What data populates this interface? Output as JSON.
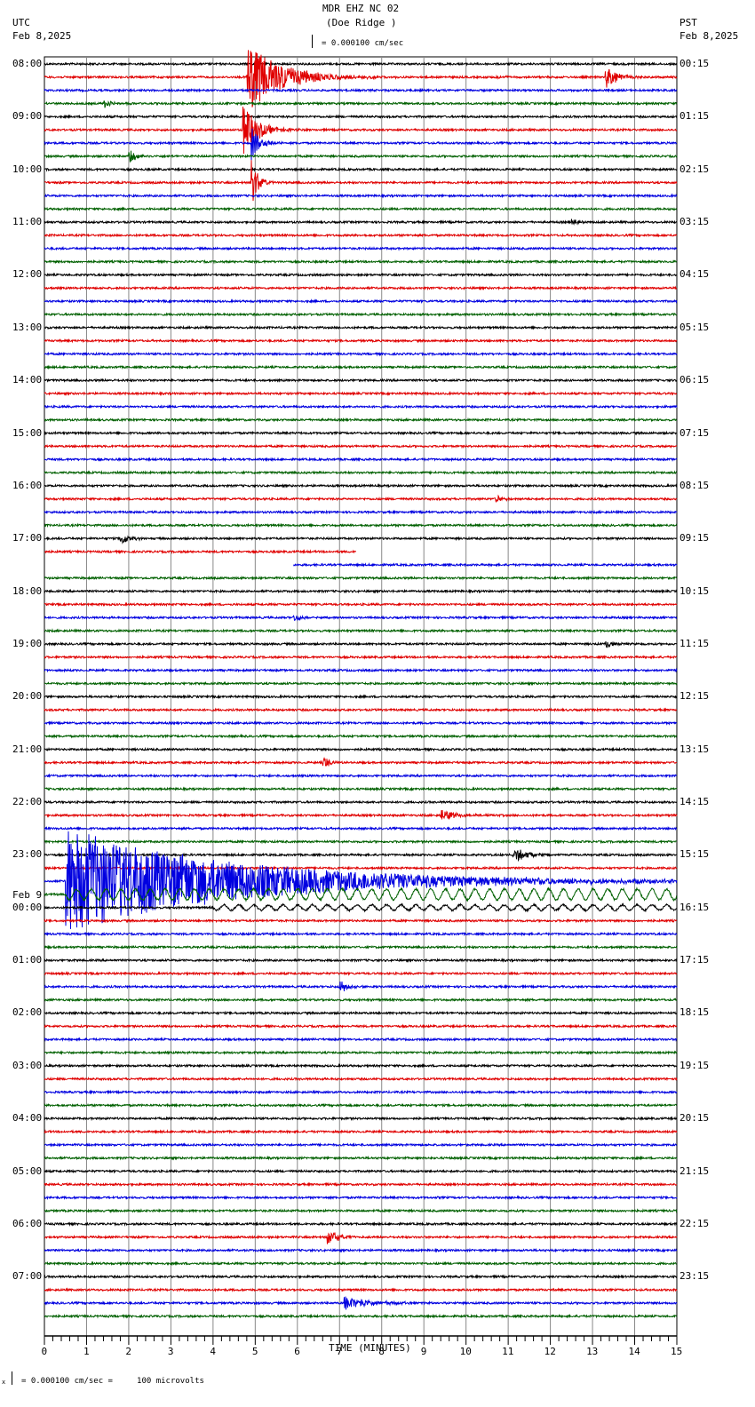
{
  "header": {
    "title": "MDR EHZ NC 02",
    "subtitle": "(Doe Ridge )",
    "scale": "= 0.000100 cm/sec",
    "left_tz": "UTC",
    "left_date": "Feb 8,2025",
    "right_tz": "PST",
    "right_date": "Feb 8,2025"
  },
  "footer": {
    "scale_note": "= 0.000100 cm/sec =     100 microvolts",
    "scale_prefix": "x"
  },
  "chart_data": {
    "type": "line",
    "title": "MDR EHZ NC 02 (Doe Ridge )",
    "xlabel": "TIME (MINUTES)",
    "xlim": [
      0,
      15
    ],
    "x_ticks": [
      "0",
      "1",
      "2",
      "3",
      "4",
      "5",
      "6",
      "7",
      "8",
      "9",
      "10",
      "11",
      "12",
      "13",
      "14",
      "15"
    ],
    "traces_per_hour": 4,
    "trace_count": 96,
    "trace_colors": [
      "#000000",
      "#e00000",
      "#0000e0",
      "#006000"
    ],
    "left_labels": [
      "08:00",
      "09:00",
      "10:00",
      "11:00",
      "12:00",
      "13:00",
      "14:00",
      "15:00",
      "16:00",
      "17:00",
      "18:00",
      "19:00",
      "20:00",
      "21:00",
      "22:00",
      "23:00",
      "00:00",
      "01:00",
      "02:00",
      "03:00",
      "04:00",
      "05:00",
      "06:00",
      "07:00"
    ],
    "date_change_label": "Feb 9",
    "right_labels": [
      "00:15",
      "01:15",
      "02:15",
      "03:15",
      "04:15",
      "05:15",
      "06:15",
      "07:15",
      "08:15",
      "09:15",
      "10:15",
      "11:15",
      "12:15",
      "13:15",
      "14:15",
      "15:15",
      "16:15",
      "17:15",
      "18:15",
      "19:15",
      "20:15",
      "21:15",
      "22:15",
      "23:15"
    ],
    "events": [
      {
        "trace": 1,
        "minute": 4.8,
        "amp": 40,
        "dur": 1.2
      },
      {
        "trace": 1,
        "minute": 13.3,
        "amp": 14,
        "dur": 0.4
      },
      {
        "trace": 1,
        "minute": 10.7,
        "amp": 4,
        "dur": 0.2
      },
      {
        "trace": 3,
        "minute": 1.4,
        "amp": 6,
        "dur": 0.3
      },
      {
        "trace": 5,
        "minute": 4.7,
        "amp": 30,
        "dur": 0.5
      },
      {
        "trace": 6,
        "minute": 4.9,
        "amp": 20,
        "dur": 0.3
      },
      {
        "trace": 7,
        "minute": 2.0,
        "amp": 9,
        "dur": 0.3
      },
      {
        "trace": 9,
        "minute": 4.9,
        "amp": 35,
        "dur": 0.2
      },
      {
        "trace": 12,
        "minute": 12.5,
        "amp": 4,
        "dur": 0.2
      },
      {
        "trace": 33,
        "minute": 10.7,
        "amp": 5,
        "dur": 0.2
      },
      {
        "trace": 36,
        "minute": 1.8,
        "amp": 8,
        "dur": 0.3
      },
      {
        "trace": 42,
        "minute": 5.9,
        "amp": 6,
        "dur": 0.2
      },
      {
        "trace": 44,
        "minute": 13.3,
        "amp": 5,
        "dur": 0.3
      },
      {
        "trace": 53,
        "minute": 6.6,
        "amp": 10,
        "dur": 0.2
      },
      {
        "trace": 57,
        "minute": 9.4,
        "amp": 8,
        "dur": 0.5
      },
      {
        "trace": 60,
        "minute": 11.1,
        "amp": 8,
        "dur": 0.6
      },
      {
        "trace": 62,
        "minute": 0.5,
        "amp": 60,
        "dur": 6.0
      },
      {
        "trace": 70,
        "minute": 7.0,
        "amp": 9,
        "dur": 0.3
      },
      {
        "trace": 89,
        "minute": 6.7,
        "amp": 9,
        "dur": 0.4
      },
      {
        "trace": 94,
        "minute": 7.1,
        "amp": 8,
        "dur": 0.9
      }
    ],
    "long_period": [
      {
        "trace": 63,
        "start": 0.5,
        "amp": 6,
        "period": 0.35
      },
      {
        "trace": 64,
        "start": 4.0,
        "amp": 3,
        "period": 0.35
      }
    ],
    "gaps": [
      {
        "trace": 37,
        "from": 7.4,
        "to": 15
      },
      {
        "trace": 38,
        "from": 0,
        "to": 5.9
      }
    ]
  }
}
